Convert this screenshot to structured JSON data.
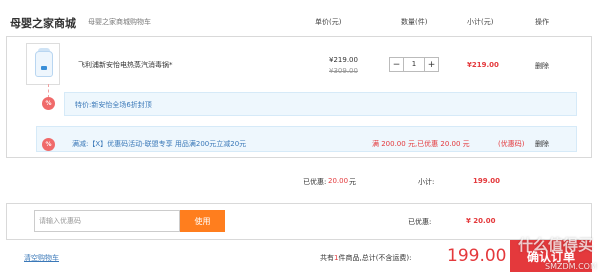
{
  "header": {
    "store_name": "母婴之家商城",
    "store_sub": "母婴之家商城购物车",
    "col_price": "单价(元)",
    "col_qty": "数量(件)",
    "col_subtotal": "小计(元)",
    "col_action": "操作"
  },
  "item": {
    "name": "飞利浦新安怡电热蒸汽消毒锅*",
    "price": "¥219.00",
    "old_price": "¥309.00",
    "qty": "1",
    "minus_symbol": "−",
    "plus_symbol": "+",
    "subtotal": "¥219.00",
    "delete_label": "删除"
  },
  "item_promo": {
    "badge": "%",
    "text": "特价:新安怡全场6折封顶"
  },
  "full_promo": {
    "badge": "%",
    "text": "满减:【X】优惠码活动-联盟专享 用品满200元立减20元",
    "amount_text": "满 200.00 元,已优惠 20.00 元",
    "coupon_link": "(优惠码)",
    "delete_label": "删除"
  },
  "totals": {
    "saved_label": "已优惠:",
    "saved_value": "20.00",
    "saved_unit": "元",
    "subtotal_label": "小计:",
    "subtotal_value": "199.00"
  },
  "coupon": {
    "placeholder": "请输入优惠码",
    "button_label": "使用",
    "discount_label": "已优惠:",
    "discount_value": "¥ 20.00"
  },
  "footer": {
    "clear_cart": "清空购物车",
    "total_prefix": "共有",
    "total_count": "1",
    "total_suffix": "件商品,总计(不含运费):",
    "total_amount": "199.00",
    "checkout_label": "确认订单",
    "watermark": "什么值得买",
    "watermark_sub": "SMZDM.COM"
  },
  "colors": {
    "accent_red": "#e4393c",
    "use_button_orange": "#ff7e1e",
    "promo_blue": "#3a78b8",
    "promo_background": "#eef7fd",
    "badge_pink": "#f06a6a"
  },
  "icons": {
    "product_thumbnail": "steam-sterilizer-image",
    "promo_badge": "percent-badge-icon"
  }
}
